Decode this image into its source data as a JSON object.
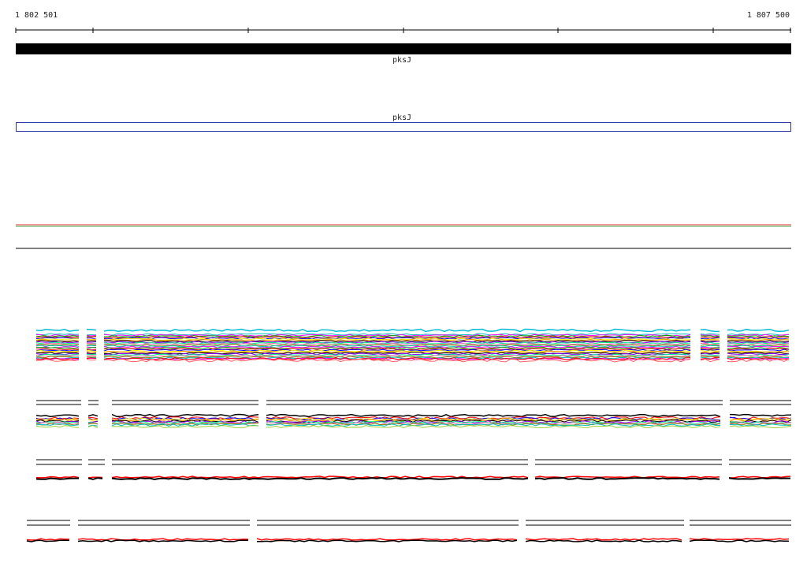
{
  "ruler": {
    "start": "1 802 501",
    "end": "1 807 500"
  },
  "gene": {
    "name": "pksJ",
    "model_name": "pksJ"
  },
  "colors": {
    "gene": "#000000",
    "gene_model_outline": "#2233aa",
    "coverage_top": "#e53935",
    "coverage_bottom": "#43a047",
    "axis": "#000000"
  },
  "alignment_palette": [
    "#00c0c0",
    "#ff00ff",
    "#00b000",
    "#ff0000",
    "#0000ff",
    "#ffff00",
    "#ff8800",
    "#000000",
    "#8800ff",
    "#00ff80",
    "#ff69b4",
    "#808000"
  ]
}
